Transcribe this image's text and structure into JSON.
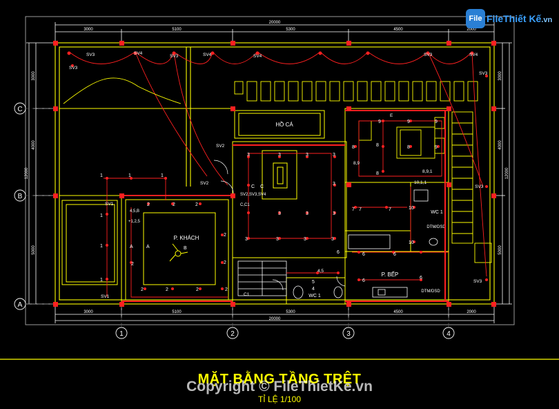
{
  "drawing": {
    "title": "MẶT BẰNG TẦNG TRỆT",
    "scale": "TỈ LỆ 1/100",
    "watermark": "Copyright © FileThietKe.vn",
    "logo_text": "FileThiết Kế",
    "logo_domain": ".vn",
    "logo_badge": "File"
  },
  "dimensions": {
    "overall_top": "20000",
    "overall_bottom": "20000",
    "spans_top": [
      "3000",
      "5100",
      "5300",
      "4500",
      "2000"
    ],
    "spans_bottom": [
      "3000",
      "5100",
      "5300",
      "4500",
      "2000"
    ],
    "left_overall": "12000",
    "left_spans": [
      "3000",
      "4000",
      "5000"
    ],
    "right_overall": "12000",
    "right_spans": [
      "3000",
      "4000",
      "5000"
    ]
  },
  "grid_axes": {
    "columns": [
      "1",
      "2",
      "3",
      "4"
    ],
    "rows": [
      "C",
      "B",
      "A"
    ]
  },
  "rooms": {
    "ho_ca": "HỒ CÁ",
    "p_khach": "P. KHÁCH",
    "p_bep": "P. BẾP",
    "wc1": "WC 1",
    "wc1_right": "WC 1",
    "dtm1": "DTM/DSD",
    "dtm2": "DTM/DSD"
  },
  "switch_labels": {
    "top_row": [
      "SV3",
      "SV4",
      "SV3",
      "SV4",
      "SV4",
      "SV3",
      "SV4"
    ],
    "sv3_left": "SV3",
    "sv3_right_top": "SV3",
    "sv3_right_mid": "SV3",
    "sv3_right_bot": "SV3",
    "sv2_a": "SV2",
    "sv2_b": "SV2",
    "sv1_top": "SV1",
    "sv1_bot": "SV1",
    "c1": "C1",
    "svgroup": "SV2,SV3,SV4",
    "a_b": "4,5,B",
    "a_b2": "+1,2,5",
    "c_label": "C,C1",
    "e_label": "E",
    "n89": "8,9",
    "n891": "8,9,1",
    "n1011": "10,1,1",
    "n45": "4,5",
    "label_a": "A",
    "label_a2": "A",
    "label_b": "B",
    "label_c": "C",
    "label_c2": "C"
  },
  "circuit_numbers": {
    "n1": "1",
    "n2": "2",
    "n3": "3",
    "n4": "4",
    "n5": "5",
    "n6": "6",
    "n7": "7",
    "n8": "8",
    "n9": "9",
    "n10": "10"
  }
}
